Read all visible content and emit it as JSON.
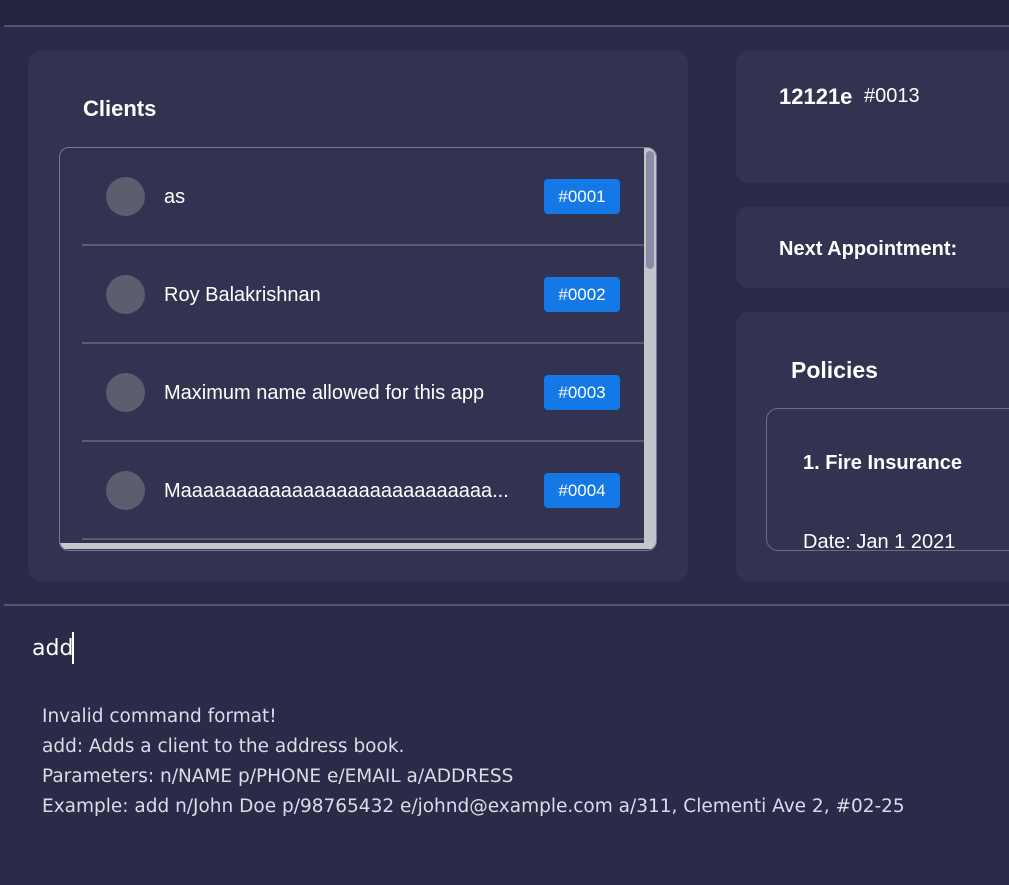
{
  "clients_panel": {
    "title": "Clients",
    "items": [
      {
        "name": "as",
        "id": "#0001"
      },
      {
        "name": "Roy Balakrishnan",
        "id": "#0002"
      },
      {
        "name": "Maximum name allowed for this app",
        "id": "#0003"
      },
      {
        "name": "Maaaaaaaaaaaaaaaaaaaaaaaaaaaa...",
        "id": "#0004"
      }
    ]
  },
  "person": {
    "name": "12121e",
    "id": "#0013"
  },
  "appointment": {
    "label": "Next Appointment:"
  },
  "policies": {
    "title": "Policies",
    "items": [
      {
        "title": "1.  Fire Insurance",
        "date": "Date:  Jan 1 2021"
      }
    ]
  },
  "command": {
    "value": "add"
  },
  "result": {
    "lines": [
      "Invalid command format!",
      "add: Adds a client to the address book.",
      "Parameters: n/NAME p/PHONE e/EMAIL a/ADDRESS",
      "Example: add n/John Doe p/98765432 e/johnd@example.com a/311, Clementi Ave 2, #02-25"
    ]
  },
  "colors": {
    "background": "#2a2b48",
    "panel": "#323350",
    "badge": "#1478e6"
  }
}
